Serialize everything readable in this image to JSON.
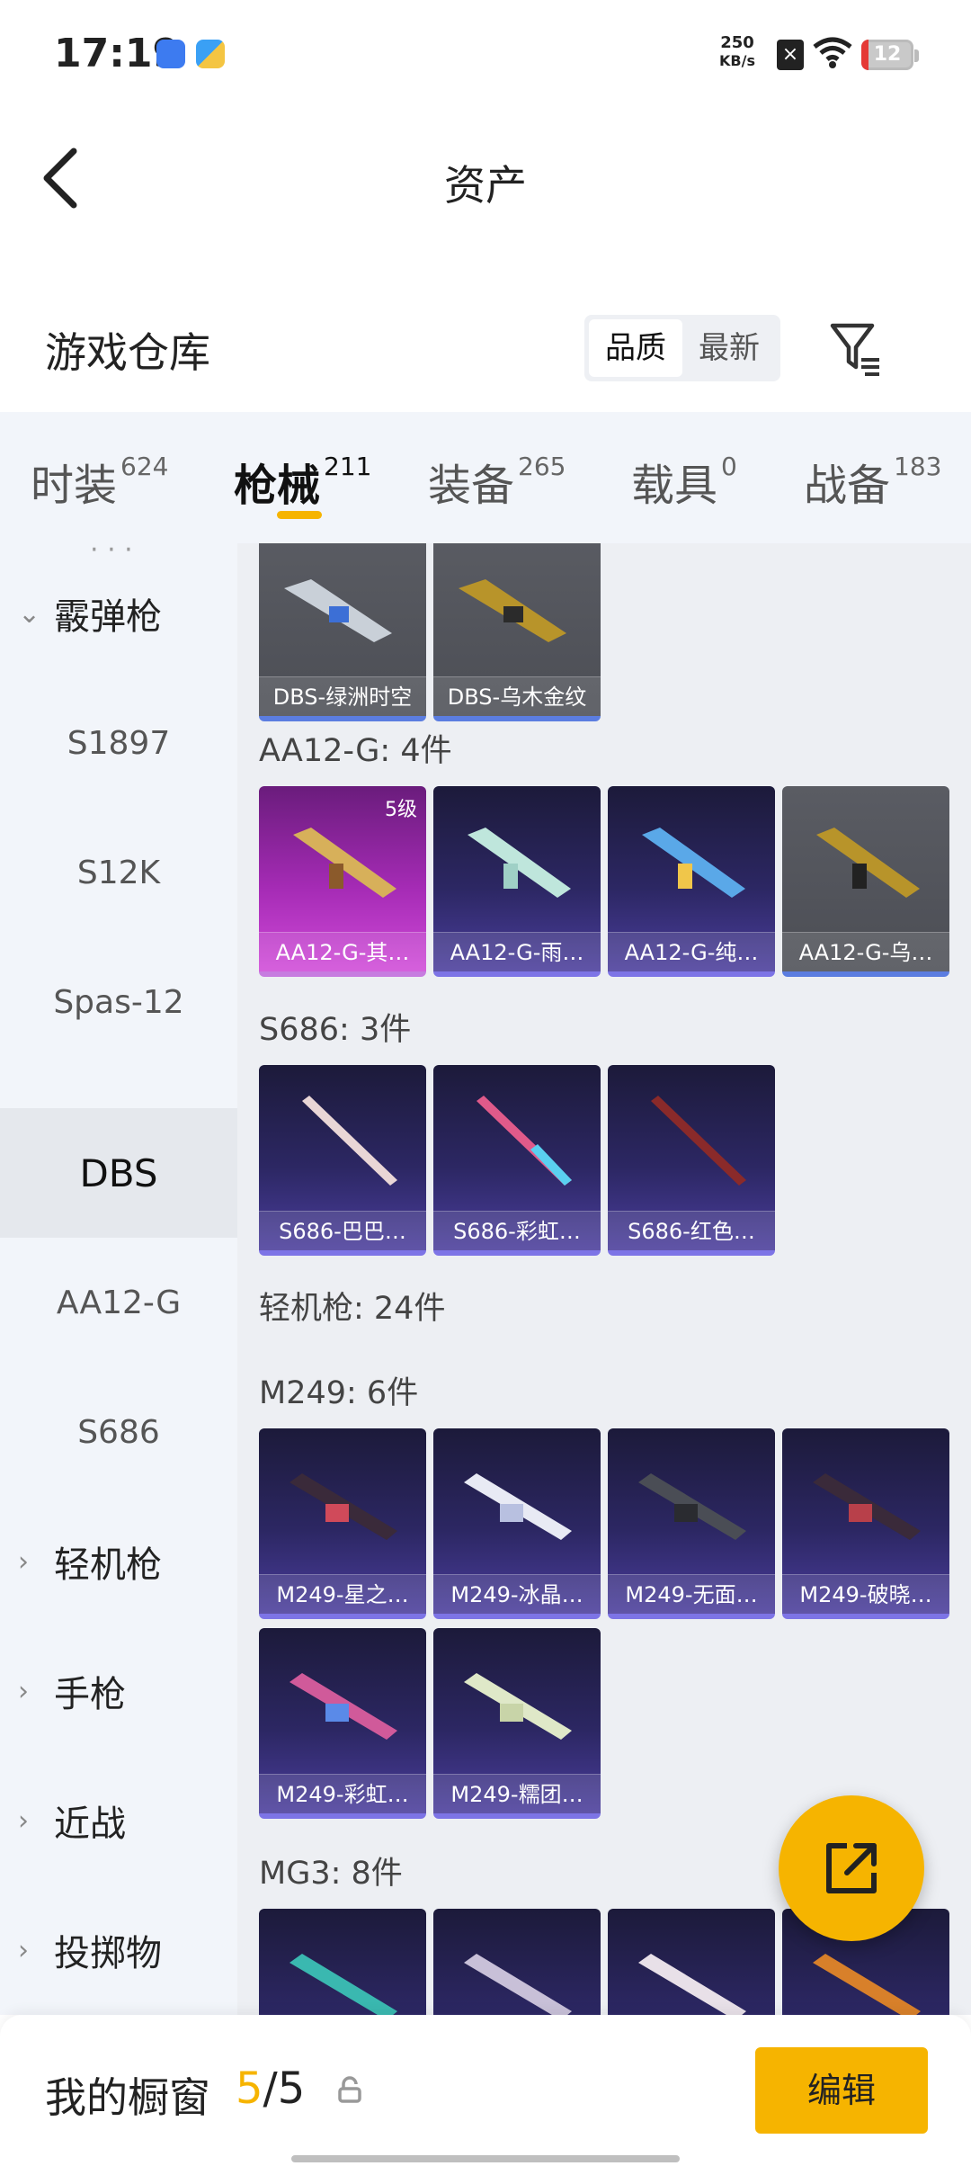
{
  "status": {
    "time": "17:19",
    "net_speed": "250",
    "net_unit": "KB/s",
    "battery": "12"
  },
  "header": {
    "title": "资产"
  },
  "warehouse": {
    "title": "游戏仓库",
    "sort_options": [
      "品质",
      "最新"
    ],
    "sort_active": "品质"
  },
  "tabs": [
    {
      "label": "时装",
      "count": "624"
    },
    {
      "label": "枪械",
      "count": "211"
    },
    {
      "label": "装备",
      "count": "265"
    },
    {
      "label": "载具",
      "count": "0"
    },
    {
      "label": "战备",
      "count": "183"
    }
  ],
  "active_tab": "枪械",
  "sidebar": {
    "items": [
      {
        "label": "霰弹枪",
        "type": "group",
        "expanded": true
      },
      {
        "label": "S1897",
        "type": "sub"
      },
      {
        "label": "S12K",
        "type": "sub"
      },
      {
        "label": "Spas-12",
        "type": "sub"
      },
      {
        "label": "DBS",
        "type": "sub",
        "active": true
      },
      {
        "label": "AA12-G",
        "type": "sub"
      },
      {
        "label": "S686",
        "type": "sub"
      },
      {
        "label": "轻机枪",
        "type": "group"
      },
      {
        "label": "手枪",
        "type": "group"
      },
      {
        "label": "近战",
        "type": "group"
      },
      {
        "label": "投掷物",
        "type": "group"
      }
    ]
  },
  "sections": {
    "dbs_cards": [
      {
        "name": "DBS-绿洲时空",
        "style": "gray"
      },
      {
        "name": "DBS-乌木金纹",
        "style": "gray"
      }
    ],
    "aa12": {
      "label": "AA12-G: 4件",
      "cards": [
        {
          "name": "AA12-G-其…",
          "style": "pink",
          "grade": "5级"
        },
        {
          "name": "AA12-G-雨…",
          "style": "purple"
        },
        {
          "name": "AA12-G-纯…",
          "style": "purple"
        },
        {
          "name": "AA12-G-乌…",
          "style": "gray"
        }
      ]
    },
    "s686": {
      "label": "S686: 3件",
      "cards": [
        {
          "name": "S686-巴巴…",
          "style": "purple"
        },
        {
          "name": "S686-彩虹…",
          "style": "purple"
        },
        {
          "name": "S686-红色…",
          "style": "purple"
        }
      ]
    },
    "lmg": {
      "label": "轻机枪: 24件"
    },
    "m249": {
      "label": "M249: 6件",
      "cards": [
        {
          "name": "M249-星之…",
          "style": "purple"
        },
        {
          "name": "M249-冰晶…",
          "style": "purple"
        },
        {
          "name": "M249-无面…",
          "style": "purple"
        },
        {
          "name": "M249-破晓…",
          "style": "purple"
        },
        {
          "name": "M249-彩虹…",
          "style": "purple"
        },
        {
          "name": "M249-糯团…",
          "style": "purple"
        }
      ]
    },
    "mg3": {
      "label": "MG3: 8件"
    }
  },
  "bottom": {
    "showcase_label": "我的橱窗",
    "showcase_current": "5",
    "showcase_sep": "/",
    "showcase_total": "5",
    "edit_label": "编辑"
  },
  "colors": {
    "accent": "#f6b400",
    "card_purple": "#2c2763",
    "card_pink": "#a52bb5",
    "card_gray": "#55575e"
  }
}
